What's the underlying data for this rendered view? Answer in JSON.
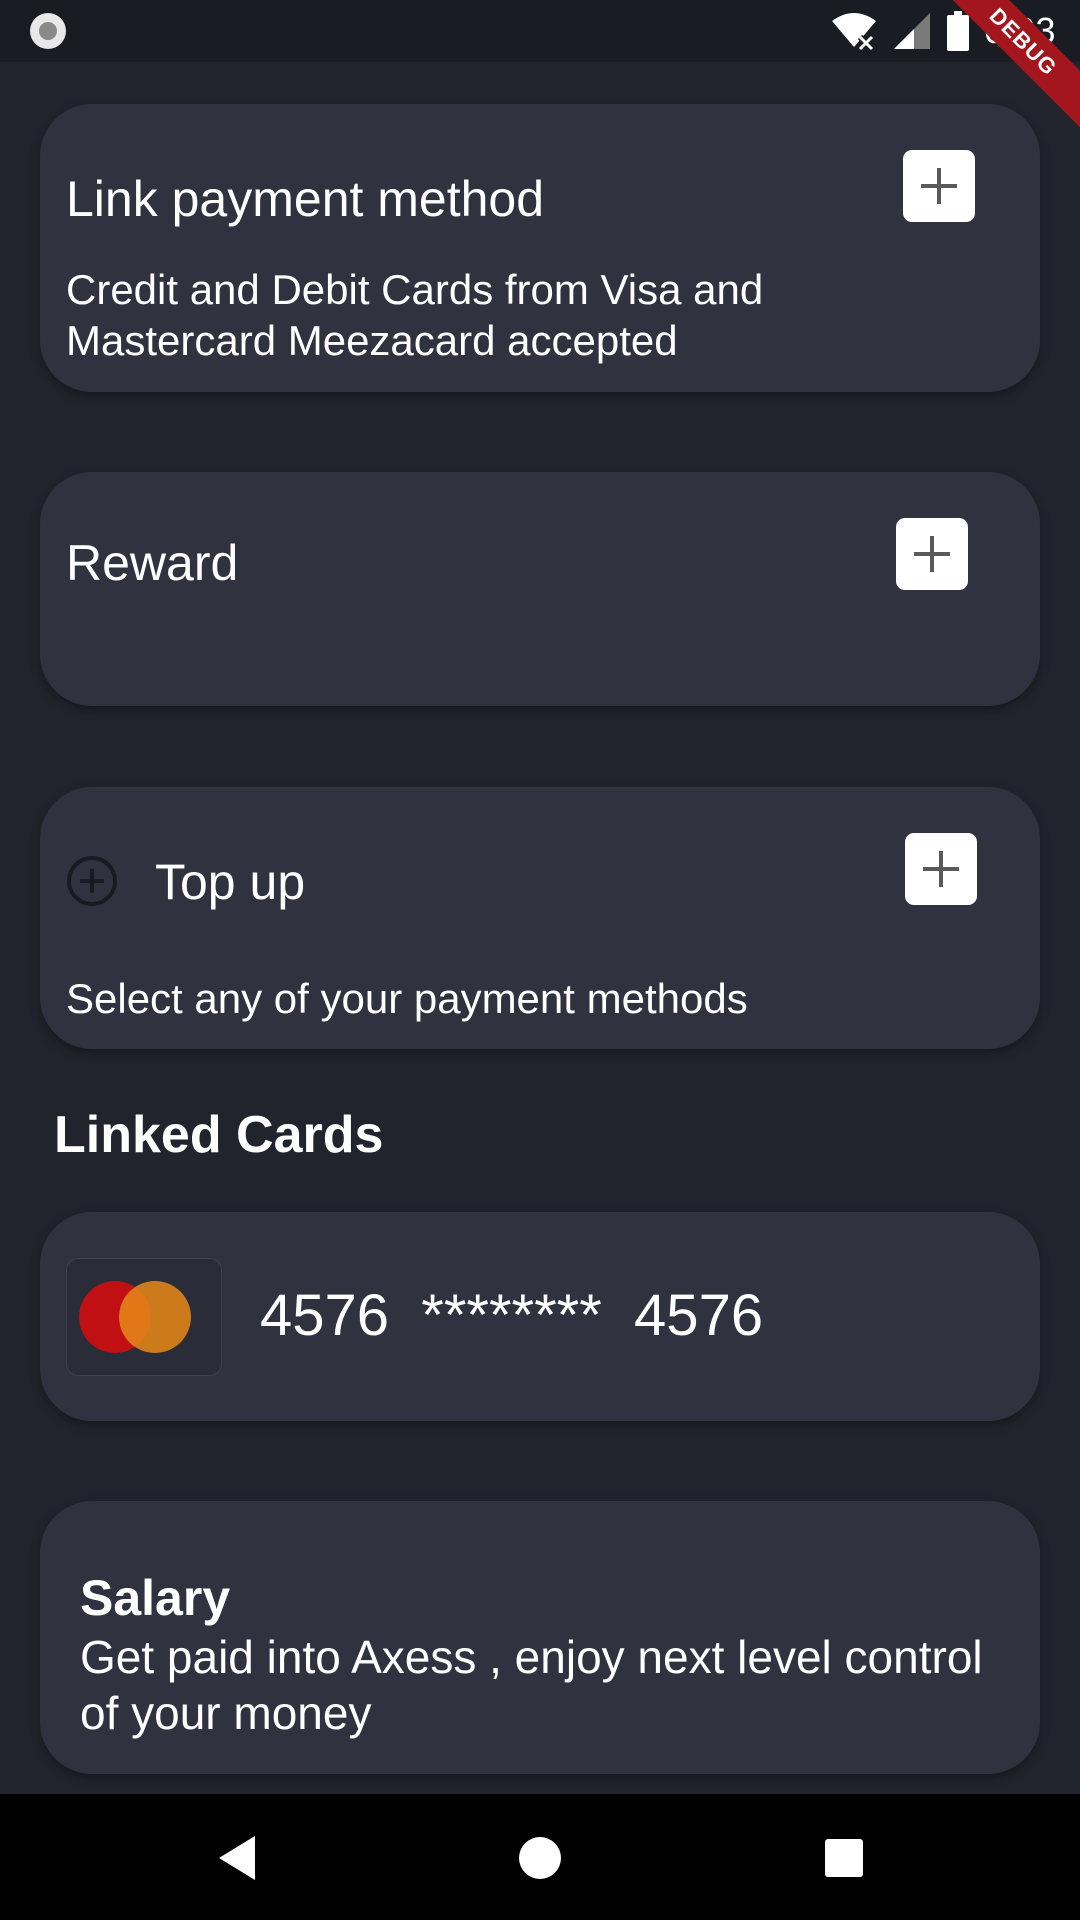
{
  "status_bar": {
    "time": "6:03",
    "debug_label": "DEBUG",
    "icons": [
      "record-icon",
      "wifi-off-icon",
      "cell-signal-icon",
      "battery-icon"
    ]
  },
  "link_payment": {
    "title": "Link payment method",
    "subtitle": "Credit and Debit Cards from Visa and Mastercard Meezacard accepted"
  },
  "reward": {
    "title": "Reward"
  },
  "top_up": {
    "title": "Top up",
    "subtitle": "Select any of your payment methods"
  },
  "linked_cards": {
    "heading": "Linked Cards",
    "cards": [
      {
        "number": "4576  ********  4576",
        "brand": "mastercard"
      }
    ]
  },
  "salary": {
    "title": "Salary",
    "text": "Get paid into Axess , enjoy next level control of your money"
  },
  "colors": {
    "background": "#22242d",
    "card": "#30323f",
    "debug": "#a3161d",
    "mastercard_red": "#c01014",
    "mastercard_orange": "#e88a17"
  }
}
